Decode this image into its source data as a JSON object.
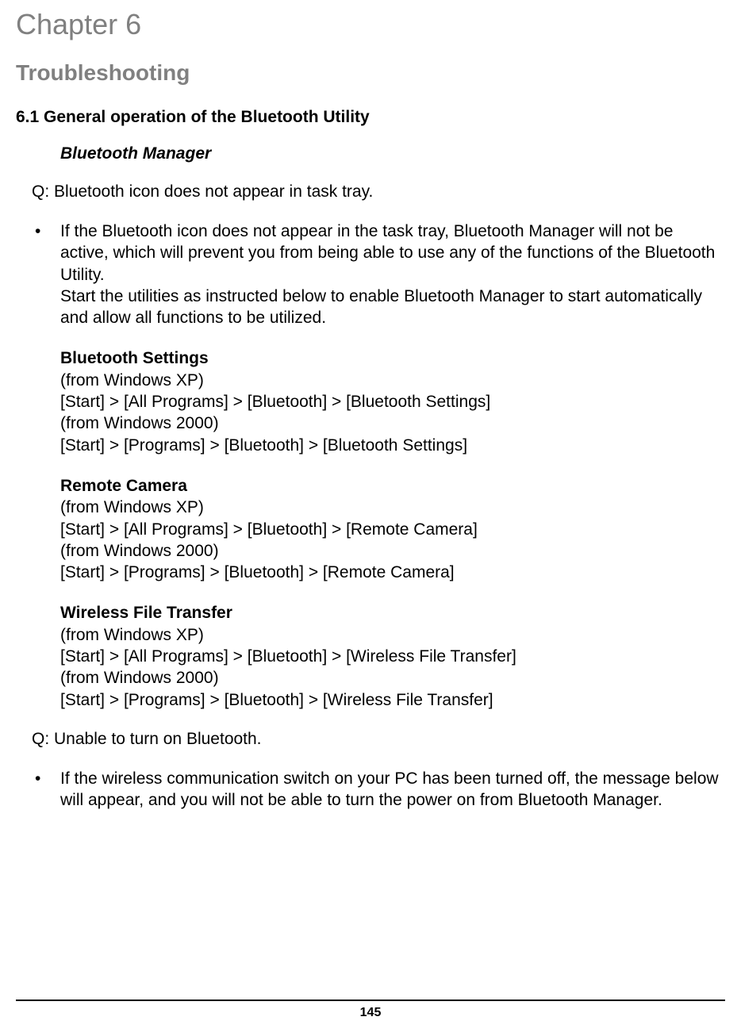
{
  "chapter": "Chapter 6",
  "title": "Troubleshooting",
  "subsection": "6.1  General operation of the Bluetooth Utility",
  "bt_manager": "Bluetooth Manager",
  "q1": "Q: Bluetooth icon does not appear in task tray.",
  "b1_p1": "If the Bluetooth icon does not appear in the task tray, Bluetooth Manager will not be active, which will prevent you from being able to use any of the functions of the Bluetooth Utility.",
  "b1_p2": "Start the utilities as instructed below to enable Bluetooth Manager to start automatically and allow all functions to be utilized.",
  "settings": {
    "title": "Bluetooth Settings",
    "xp_label": "(from Windows XP)",
    "xp_path": "[Start] > [All Programs] > [Bluetooth] > [Bluetooth Settings]",
    "w2k_label": "(from Windows 2000)",
    "w2k_path": "[Start] > [Programs] > [Bluetooth] > [Bluetooth Settings]"
  },
  "camera": {
    "title": "Remote Camera",
    "xp_label": "(from Windows XP)",
    "xp_path": "[Start] > [All Programs] > [Bluetooth] > [Remote Camera]",
    "w2k_label": "(from Windows 2000)",
    "w2k_path": "[Start] > [Programs] > [Bluetooth] > [Remote Camera]"
  },
  "wft": {
    "title": "Wireless File Transfer",
    "xp_label": "(from Windows XP)",
    "xp_path": "[Start] > [All Programs] > [Bluetooth] > [Wireless File Transfer]",
    "w2k_label": "(from Windows 2000)",
    "w2k_path": "[Start] > [Programs] > [Bluetooth] > [Wireless File Transfer]"
  },
  "q2": "Q: Unable to turn on Bluetooth.",
  "b2_p1": "If the wireless communication switch on your PC has been turned off, the message below will appear, and you will not be able to turn the power on from Bluetooth Manager.",
  "page_number": "145"
}
